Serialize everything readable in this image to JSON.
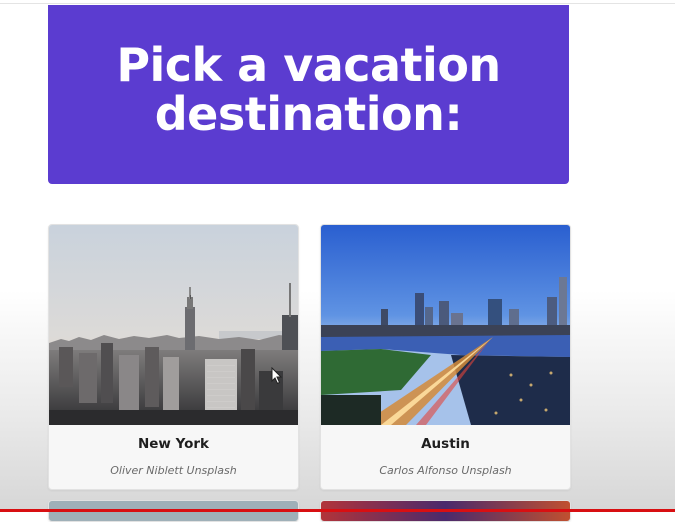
{
  "page": {
    "heading": "Pick a vacation destination:",
    "accent_color": "#5b3cd0"
  },
  "destinations": [
    {
      "name": "New York",
      "credit": "Oliver Niblett Unsplash",
      "image": "new-york-skyline-photo"
    },
    {
      "name": "Austin",
      "credit": "Carlos Alfonso Unsplash",
      "image": "austin-skyline-dusk-photo"
    }
  ],
  "status": {
    "progress_bar_color": "#d80f12"
  }
}
